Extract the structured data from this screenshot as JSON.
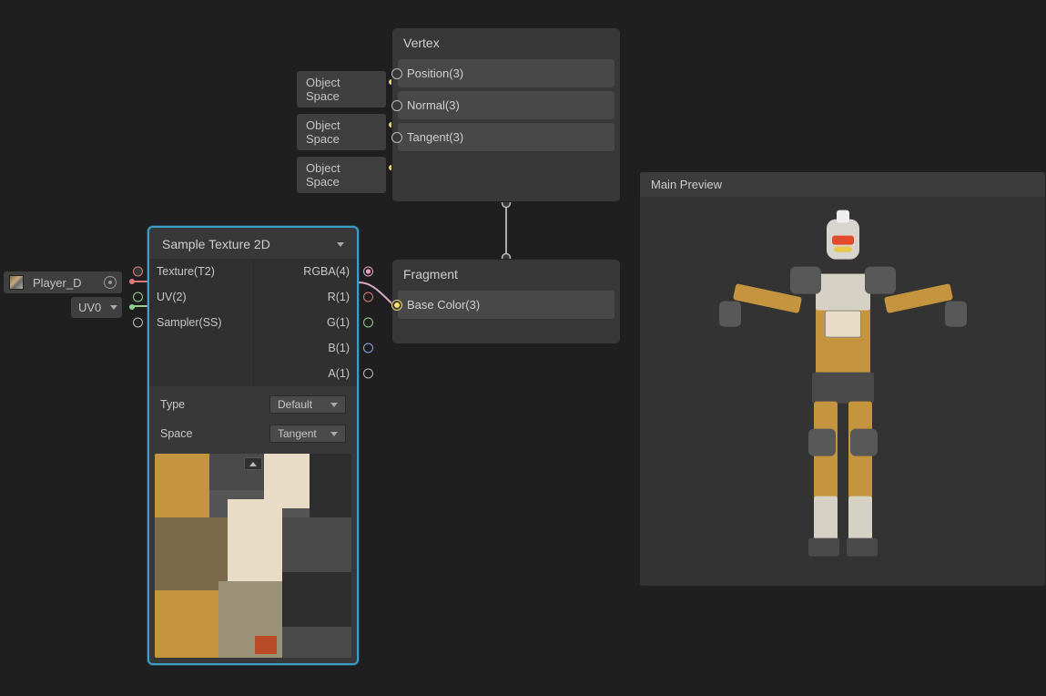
{
  "external": {
    "texture_asset": {
      "name": "Player_D"
    },
    "uv_selector": {
      "value": "UV0"
    },
    "vertex_slot_labels": {
      "position": "Object Space",
      "normal": "Object Space",
      "tangent": "Object Space"
    }
  },
  "nodes": {
    "sample_texture": {
      "title": "Sample Texture 2D",
      "inputs": {
        "texture": "Texture(T2)",
        "uv": "UV(2)",
        "sampler": "Sampler(SS)"
      },
      "outputs": {
        "rgba": "RGBA(4)",
        "r": "R(1)",
        "g": "G(1)",
        "b": "B(1)",
        "a": "A(1)"
      },
      "props": {
        "type_label": "Type",
        "type_value": "Default",
        "space_label": "Space",
        "space_value": "Tangent"
      }
    },
    "vertex": {
      "title": "Vertex",
      "slots": {
        "position": "Position(3)",
        "normal": "Normal(3)",
        "tangent": "Tangent(3)"
      }
    },
    "fragment": {
      "title": "Fragment",
      "slots": {
        "base_color": "Base Color(3)"
      }
    }
  },
  "preview": {
    "title": "Main Preview"
  }
}
